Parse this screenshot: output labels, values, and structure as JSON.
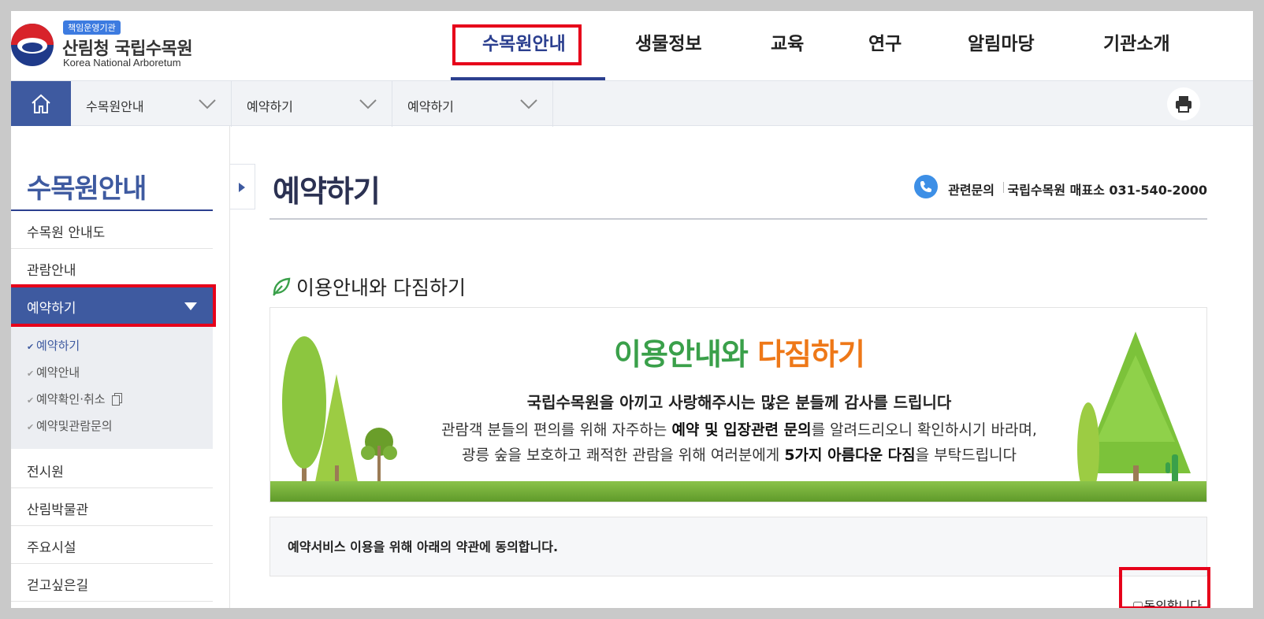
{
  "header": {
    "logo_badge": "책임운영기관",
    "logo_title": "산림청 국립수목원",
    "logo_subtitle": "Korea National Arboretum",
    "nav": [
      "수목원안내",
      "생물정보",
      "교육",
      "연구",
      "알림마당",
      "기관소개"
    ],
    "active_nav": "수목원안내"
  },
  "location": {
    "home_icon": "home-icon",
    "segments": [
      "수목원안내",
      "예약하기",
      "예약하기"
    ],
    "print_icon": "print-icon"
  },
  "sidebar": {
    "title": "수목원안내",
    "items": [
      "수목원 안내도",
      "관람안내",
      "예약하기",
      "전시원",
      "산림박물관",
      "주요시설",
      "걷고싶은길"
    ],
    "active_item": "예약하기",
    "sub_items": [
      "예약하기",
      "예약안내",
      "예약확인·취소",
      "예약및관람문의"
    ],
    "active_sub": "예약하기"
  },
  "main": {
    "page_title": "예약하기",
    "contact_label": "관련문의",
    "contact_value": "국립수목원 매표소 031-540-2000",
    "section_title": "이용안내와 다짐하기",
    "banner": {
      "heading_green": "이용안내와",
      "heading_orange": "다짐하기",
      "line1": "국립수목원을 아끼고 사랑해주시는 많은 분들께 감사를 드립니다",
      "line2_a": "관람객 분들의 편의를 위해 자주하는 ",
      "line2_b": "예약 및 입장관련 문의",
      "line2_c": "를 알려드리오니 확인하시기 바라며,",
      "line3_a": "광릉 숲을 보호하고 쾌적한 관람을 위해 여러분에게 ",
      "line3_b": "5가지 아름다운 다짐",
      "line3_c": "을 부탁드립니다"
    },
    "agree_text": "예약서비스 이용을 위해 아래의 약관에 동의합니다.",
    "agree_checkbox_label": "동의합니다.",
    "agree_checked": false
  },
  "colors": {
    "primary": "#3e5aa0",
    "highlight": "#e6001a",
    "green": "#3aa04a",
    "orange": "#ee7818"
  }
}
